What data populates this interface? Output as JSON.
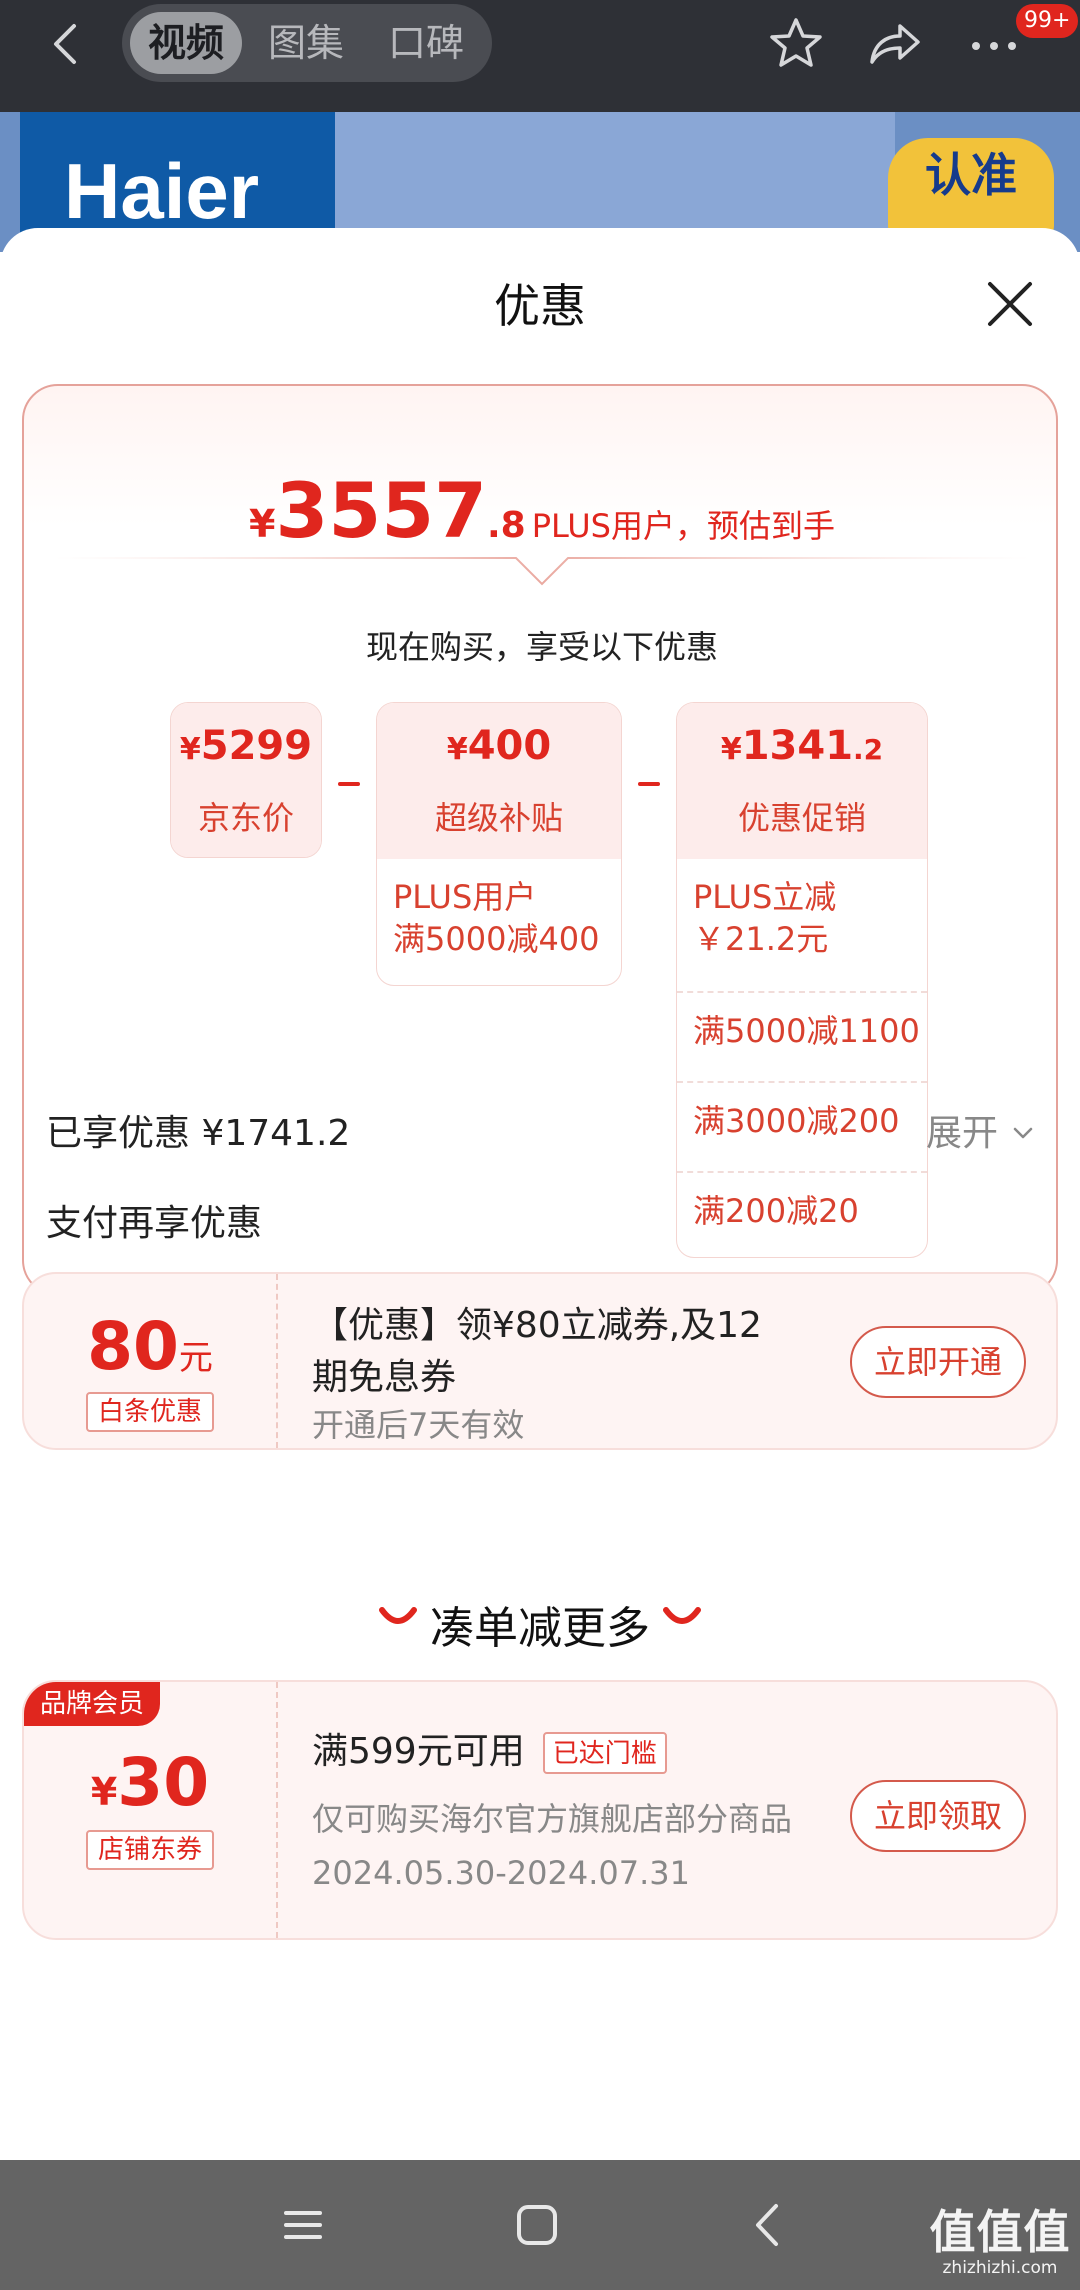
{
  "top_bar": {
    "tabs": [
      "视频",
      "图集",
      "口碑"
    ],
    "active_tab": "视频",
    "message_badge": "99+"
  },
  "hero": {
    "brand_logo_text": "Haier",
    "badge_text": "认准"
  },
  "sheet": {
    "title": "优惠",
    "price": {
      "currency": "¥",
      "integer": "3557",
      "decimal": ".8",
      "suffix": "PLUS用户，预估到手"
    },
    "subtitle": "现在购买，享受以下优惠",
    "breakdown": {
      "jd_price": {
        "yen": "¥",
        "amount": "5299",
        "label": "京东价"
      },
      "subsidy": {
        "yen": "¥",
        "amount": "400",
        "label": "超级补贴",
        "details": [
          "PLUS用户",
          "满5000减400"
        ]
      },
      "promotion": {
        "yen": "¥",
        "amount": "1341",
        "decimal": ".2",
        "label": "优惠促销",
        "details": [
          {
            "line1": "PLUS立减",
            "line2": "￥21.2元"
          },
          {
            "line1": "满5000减1100"
          },
          {
            "line1": "满3000减200"
          },
          {
            "line1": "满200减20"
          }
        ]
      }
    },
    "enjoyed": "已享优惠 ¥1741.2",
    "expand_label": "展开",
    "pay_section_title": "支付再享优惠",
    "baitiao_coupon": {
      "amount": "80",
      "unit": "元",
      "tag": "白条优惠",
      "title_line1": "【优惠】领¥80立减券,及12",
      "title_line2": "期免息券",
      "validity": "开通后7天有效",
      "button": "立即开通"
    },
    "bundle_section_title": "凑单减更多",
    "store_coupon": {
      "member_badge": "品牌会员",
      "yen": "¥",
      "amount": "30",
      "tag": "店铺东券",
      "title": "满599元可用",
      "threshold_tag": "已达门槛",
      "scope": "仅可购买海尔官方旗舰店部分商品",
      "period": "2024.05.30-2024.07.31",
      "button": "立即领取"
    }
  },
  "nav_bar": {
    "icons": [
      "menu-icon",
      "home-icon",
      "back-icon"
    ]
  },
  "watermark": {
    "text": "值值值",
    "domain": "zhizhizhi.com"
  },
  "colors": {
    "accent": "#e0261e",
    "card_bg": "#fef4f3",
    "topbar": "#2e3036",
    "navbar": "#646464"
  }
}
